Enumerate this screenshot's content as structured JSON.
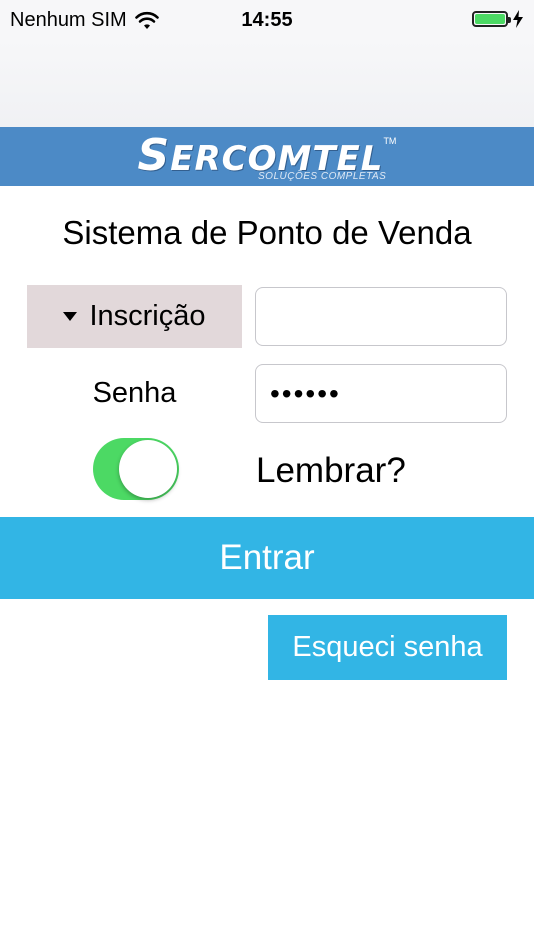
{
  "status_bar": {
    "carrier": "Nenhum SIM",
    "time": "14:55",
    "battery_color": "#4cd964"
  },
  "banner": {
    "logo_text": "ERCOMTEL",
    "logo_initial": "S",
    "logo_tm": "TM",
    "logo_subtitle": "SOLUÇÕES COMPLETAS",
    "background_color": "#4c8ac6"
  },
  "form": {
    "title": "Sistema de Ponto de Venda",
    "inscricao_label": "Inscrição",
    "inscricao_value": "",
    "senha_label": "Senha",
    "senha_value": "••••••",
    "remember_label": "Lembrar?",
    "remember_on": true
  },
  "actions": {
    "entrar_label": "Entrar",
    "forgot_label": "Esqueci senha",
    "accent_color": "#32b5e5"
  },
  "icons": {
    "wifi": "wifi-icon",
    "battery": "battery-icon",
    "charging": "bolt-icon",
    "dropdown": "caret-down-icon"
  }
}
